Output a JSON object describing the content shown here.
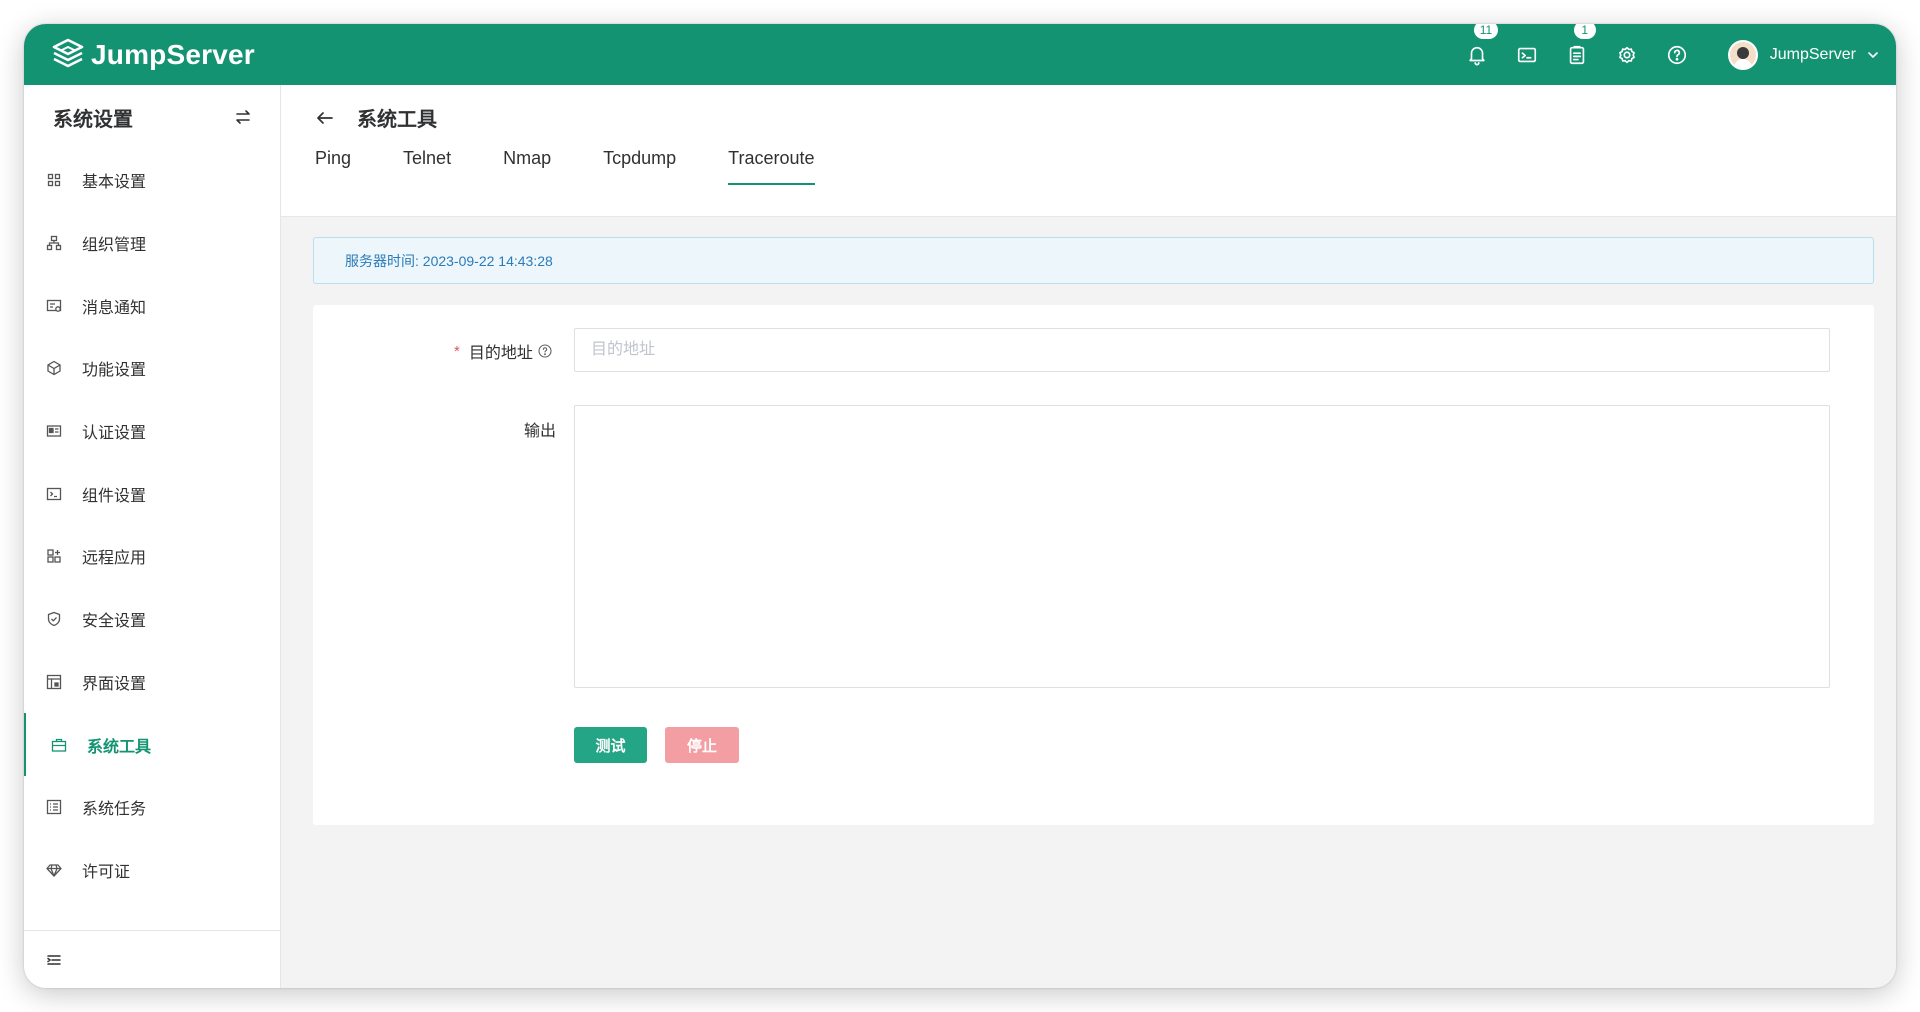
{
  "header": {
    "brand": "JumpServer",
    "notifications_badge": "11",
    "tickets_badge": "1",
    "username": "JumpServer",
    "icons": [
      "bell-icon",
      "terminal-icon",
      "clipboard-icon",
      "gear-icon",
      "help-icon"
    ]
  },
  "sidebar": {
    "title": "系统设置",
    "items": [
      {
        "label": "基本设置",
        "icon": "grid-icon"
      },
      {
        "label": "组织管理",
        "icon": "org-icon"
      },
      {
        "label": "消息通知",
        "icon": "message-icon"
      },
      {
        "label": "功能设置",
        "icon": "feature-icon"
      },
      {
        "label": "认证设置",
        "icon": "id-card-icon"
      },
      {
        "label": "组件设置",
        "icon": "console-icon"
      },
      {
        "label": "远程应用",
        "icon": "apps-icon"
      },
      {
        "label": "安全设置",
        "icon": "shield-icon"
      },
      {
        "label": "界面设置",
        "icon": "layout-icon"
      },
      {
        "label": "系统工具",
        "icon": "toolbox-icon",
        "active": true
      },
      {
        "label": "系统任务",
        "icon": "task-list-icon"
      },
      {
        "label": "许可证",
        "icon": "diamond-icon"
      }
    ]
  },
  "page": {
    "title": "系统工具",
    "tabs": [
      "Ping",
      "Telnet",
      "Nmap",
      "Tcpdump",
      "Traceroute"
    ],
    "active_tab": "Traceroute",
    "server_time": "服务器时间: 2023-09-22 14:43:28",
    "form": {
      "required_mark": "*",
      "address_label": "目的地址",
      "address_placeholder": "目的地址",
      "address_value": "",
      "output_label": "输出",
      "test_button": "测试",
      "stop_button": "停止"
    }
  },
  "colors": {
    "brand": "#149373",
    "primary_button": "#24a585",
    "danger_button_disabled": "#f29ea3",
    "info_text": "#2b7bb9"
  }
}
